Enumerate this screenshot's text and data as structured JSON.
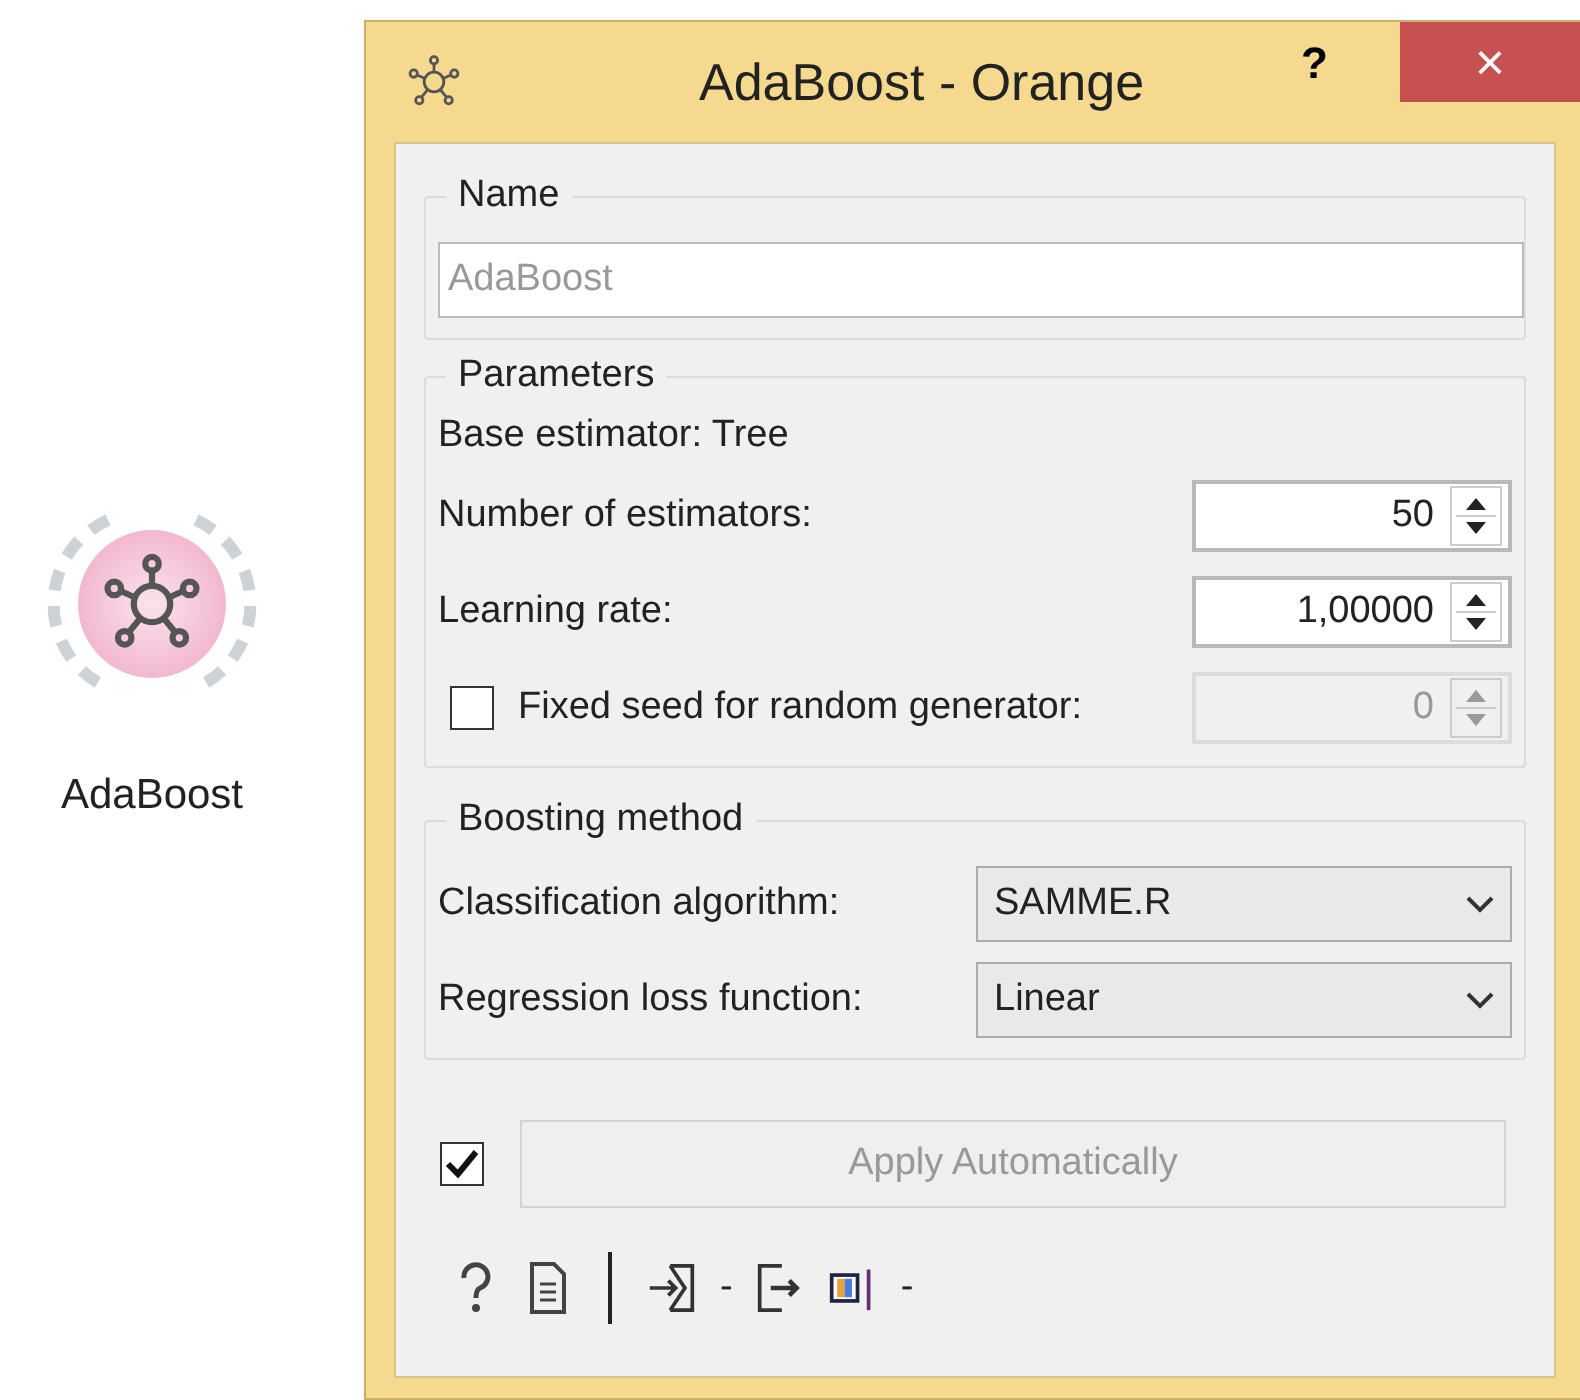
{
  "node": {
    "label": "AdaBoost"
  },
  "window": {
    "title": "AdaBoost - Orange",
    "help": "?",
    "close": "×"
  },
  "name_box": {
    "title": "Name",
    "placeholder": "AdaBoost"
  },
  "parameters": {
    "title": "Parameters",
    "base_estimator": "Base estimator: Tree",
    "rows": [
      {
        "kind": "spin",
        "label": "Number of estimators:",
        "value": "50",
        "disabled": false
      },
      {
        "kind": "spin",
        "label": "Learning rate:",
        "value": "1,00000",
        "disabled": false
      },
      {
        "kind": "check_spin",
        "label": "Fixed seed for random generator:",
        "checked": false,
        "value": "0",
        "disabled": true
      }
    ]
  },
  "boosting": {
    "title": "Boosting method",
    "rows": [
      {
        "label": "Classification algorithm:",
        "value": "SAMME.R"
      },
      {
        "label": "Regression loss function:",
        "value": "Linear"
      }
    ]
  },
  "apply": {
    "checked": true,
    "label": "Apply Automatically",
    "disabled": true
  },
  "status": {
    "input_summary": "-",
    "output_summary": "-"
  }
}
